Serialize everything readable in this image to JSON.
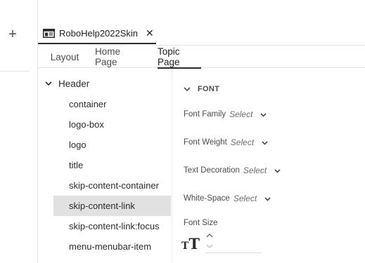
{
  "sidebar": {
    "add_label": "+"
  },
  "document_tab": {
    "title": "RoboHelp2022Skin",
    "close": "✕"
  },
  "subtabs": [
    {
      "label": "Layout"
    },
    {
      "label": "Home Page"
    },
    {
      "label": "Topic Page",
      "active": true
    }
  ],
  "tree": {
    "header": "Header",
    "items": [
      {
        "label": "container"
      },
      {
        "label": "logo-box"
      },
      {
        "label": "logo"
      },
      {
        "label": "title"
      },
      {
        "label": "skip-content-container"
      },
      {
        "label": "skip-content-link",
        "selected": true
      },
      {
        "label": "skip-content-link:focus"
      },
      {
        "label": "menu-menubar-item"
      }
    ]
  },
  "font_section": {
    "title": "FONT",
    "properties": [
      {
        "label": "Font Family",
        "value": "Select"
      },
      {
        "label": "Font Weight",
        "value": "Select"
      },
      {
        "label": "Text Decoration",
        "value": "Select"
      },
      {
        "label": "White-Space",
        "value": "Select"
      }
    ],
    "font_size_label": "Font Size",
    "font_size_icon": {
      "small": "T",
      "big": "T"
    }
  },
  "colors": {
    "selected_bg": "#e1e1e1",
    "text": "#2c2c2c",
    "muted_text": "#6e6e6e"
  },
  "icons": {
    "document": "document-tab-icon",
    "close": "close-icon",
    "plus": "plus-icon",
    "chevron": "chevron-down-icon"
  }
}
